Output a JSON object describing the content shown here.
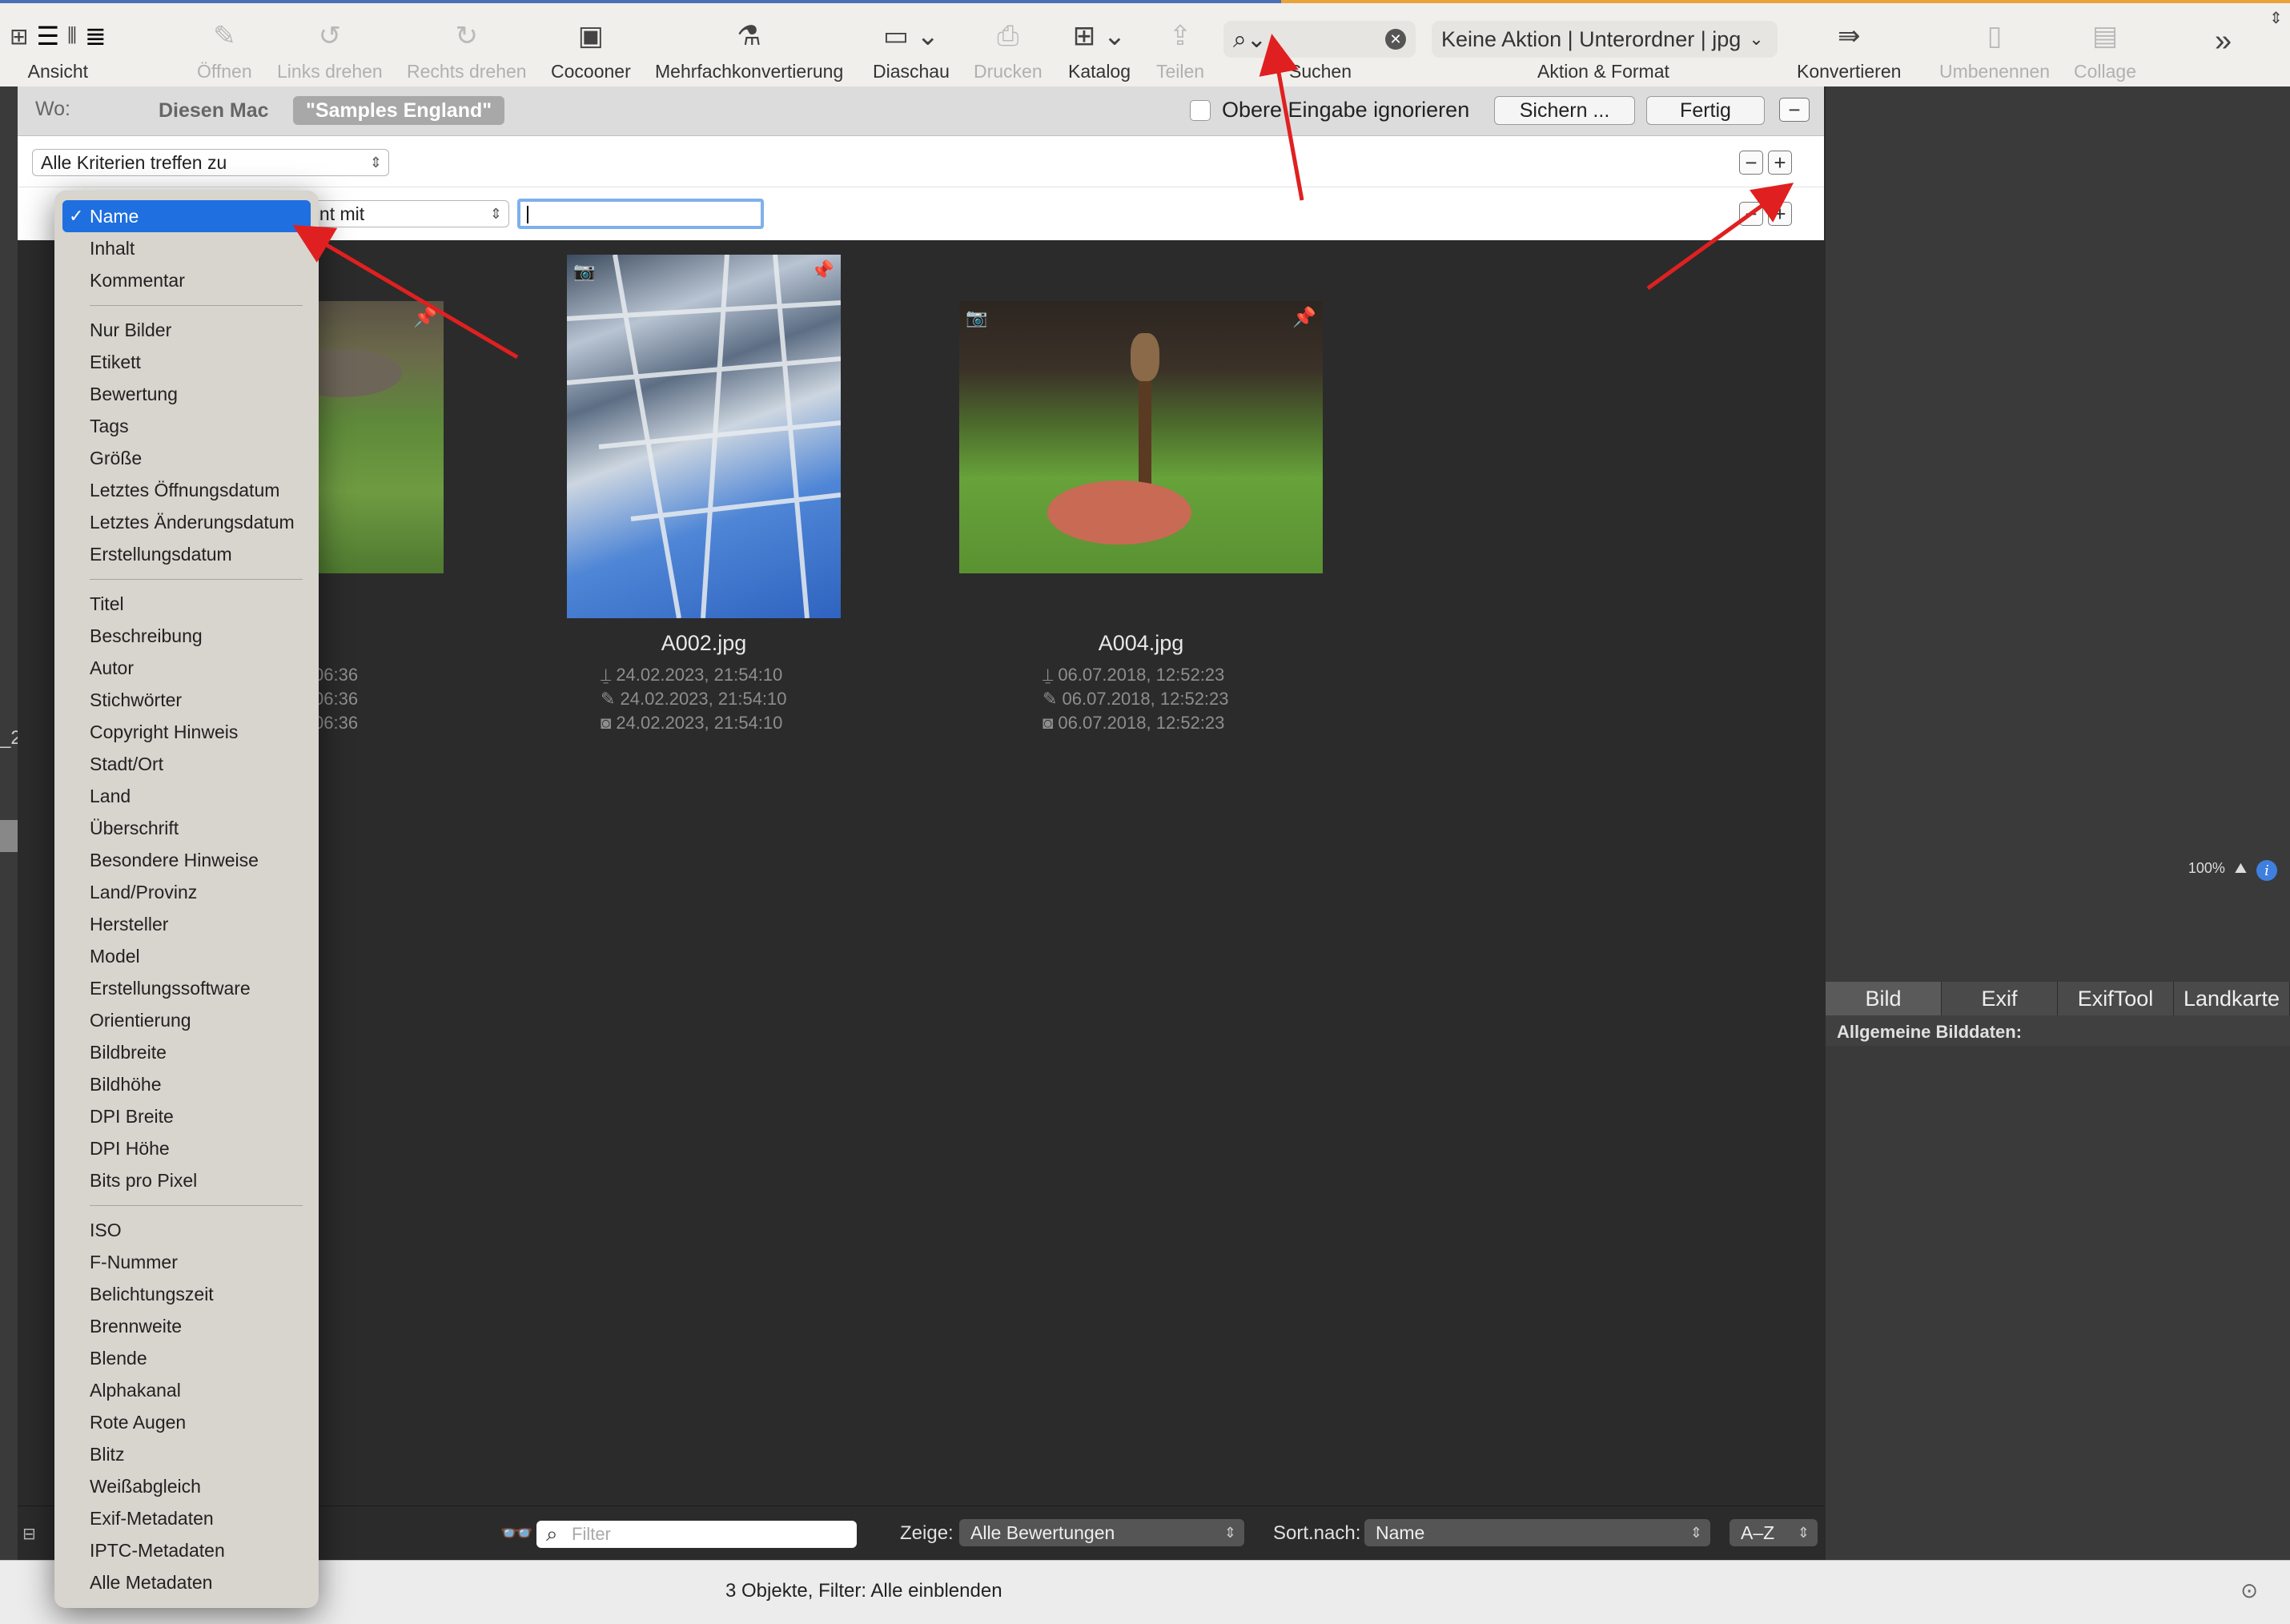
{
  "toolbar": {
    "items": [
      {
        "label": "Ansicht",
        "icon": "view-mode-icon",
        "enabled": true
      },
      {
        "label": "Öffnen",
        "icon": "open-icon",
        "enabled": false
      },
      {
        "label": "Links drehen",
        "icon": "rotate-left-icon",
        "enabled": false
      },
      {
        "label": "Rechts drehen",
        "icon": "rotate-right-icon",
        "enabled": false
      },
      {
        "label": "Cocooner",
        "icon": "cocooner-icon",
        "enabled": true
      },
      {
        "label": "Mehrfachkonvertierung",
        "icon": "batch-convert-icon",
        "enabled": true
      },
      {
        "label": "Diaschau",
        "icon": "slideshow-icon",
        "enabled": true
      },
      {
        "label": "Drucken",
        "icon": "print-icon",
        "enabled": false
      },
      {
        "label": "Katalog",
        "icon": "catalog-icon",
        "enabled": true
      },
      {
        "label": "Teilen",
        "icon": "share-icon",
        "enabled": false
      },
      {
        "label": "Suchen",
        "icon": "search-icon",
        "enabled": true
      },
      {
        "label": "Aktion & Format",
        "icon": "action-format-icon",
        "enabled": true
      },
      {
        "label": "Konvertieren",
        "icon": "convert-icon",
        "enabled": true
      },
      {
        "label": "Umbenennen",
        "icon": "rename-icon",
        "enabled": false
      },
      {
        "label": "Collage",
        "icon": "collage-icon",
        "enabled": false
      }
    ],
    "action_select": "Keine Aktion | Unterordner | jpg",
    "search_value": ""
  },
  "scope": {
    "where_label": "Wo:",
    "this_mac": "Diesen Mac",
    "folder": "\"Samples England\"",
    "ignore_label": "Obere Eingabe ignorieren",
    "save_button": "Sichern ...",
    "done_button": "Fertig"
  },
  "criteria": {
    "match_mode": "Alle Kriterien treffen zu",
    "operator": "innt mit",
    "value": ""
  },
  "menu": {
    "groups": [
      [
        "Name",
        "Inhalt",
        "Kommentar"
      ],
      [
        "Nur Bilder",
        "Etikett",
        "Bewertung",
        "Tags",
        "Größe",
        "Letztes Öffnungsdatum",
        "Letztes Änderungsdatum",
        "Erstellungsdatum"
      ],
      [
        "Titel",
        "Beschreibung",
        "Autor",
        "Stichwörter",
        "Copyright Hinweis",
        "Stadt/Ort",
        "Land",
        "Überschrift",
        "Besondere Hinweise",
        "Land/Provinz",
        "Hersteller",
        "Model",
        "Erstellungssoftware",
        "Orientierung",
        "Bildbreite",
        "Bildhöhe",
        "DPI Breite",
        "DPI Höhe",
        "Bits pro Pixel"
      ],
      [
        "ISO",
        "F-Nummer",
        "Belichtungszeit",
        "Brennweite",
        "Blende",
        "Alphakanal",
        "Rote Augen",
        "Blitz",
        "Weißabgleich",
        "Exif-Metadaten",
        "IPTC-Metadaten",
        "Alle Metadaten"
      ]
    ],
    "selected": "Name"
  },
  "files": [
    {
      "name": "",
      "created": "06:36",
      "modified": "06:36",
      "taken": "06:36"
    },
    {
      "name": "A002.jpg",
      "created": "24.02.2023, 21:54:10",
      "modified": "24.02.2023, 21:54:10",
      "taken": "24.02.2023, 21:54:10"
    },
    {
      "name": "A004.jpg",
      "created": "06.07.2018, 12:52:23",
      "modified": "06.07.2018, 12:52:23",
      "taken": "06.07.2018, 12:52:23"
    }
  ],
  "bottom": {
    "filter_placeholder": "Filter",
    "show_label": "Zeige:",
    "show_value": "Alle Bewertungen",
    "sort_label": "Sort.nach:",
    "sort_value": "Name",
    "order_value": "A–Z"
  },
  "right_panel": {
    "tabs": [
      "Bild",
      "Exif",
      "ExifTool",
      "Landkarte"
    ],
    "active_tab": "Bild",
    "section_title": "Allgemeine Bilddaten:",
    "zoom_badge": "100%"
  },
  "status": "3 Objekte, Filter: Alle einblenden",
  "colors": {
    "accent": "#1f6fe0",
    "annotation_arrow": "#e02020"
  }
}
